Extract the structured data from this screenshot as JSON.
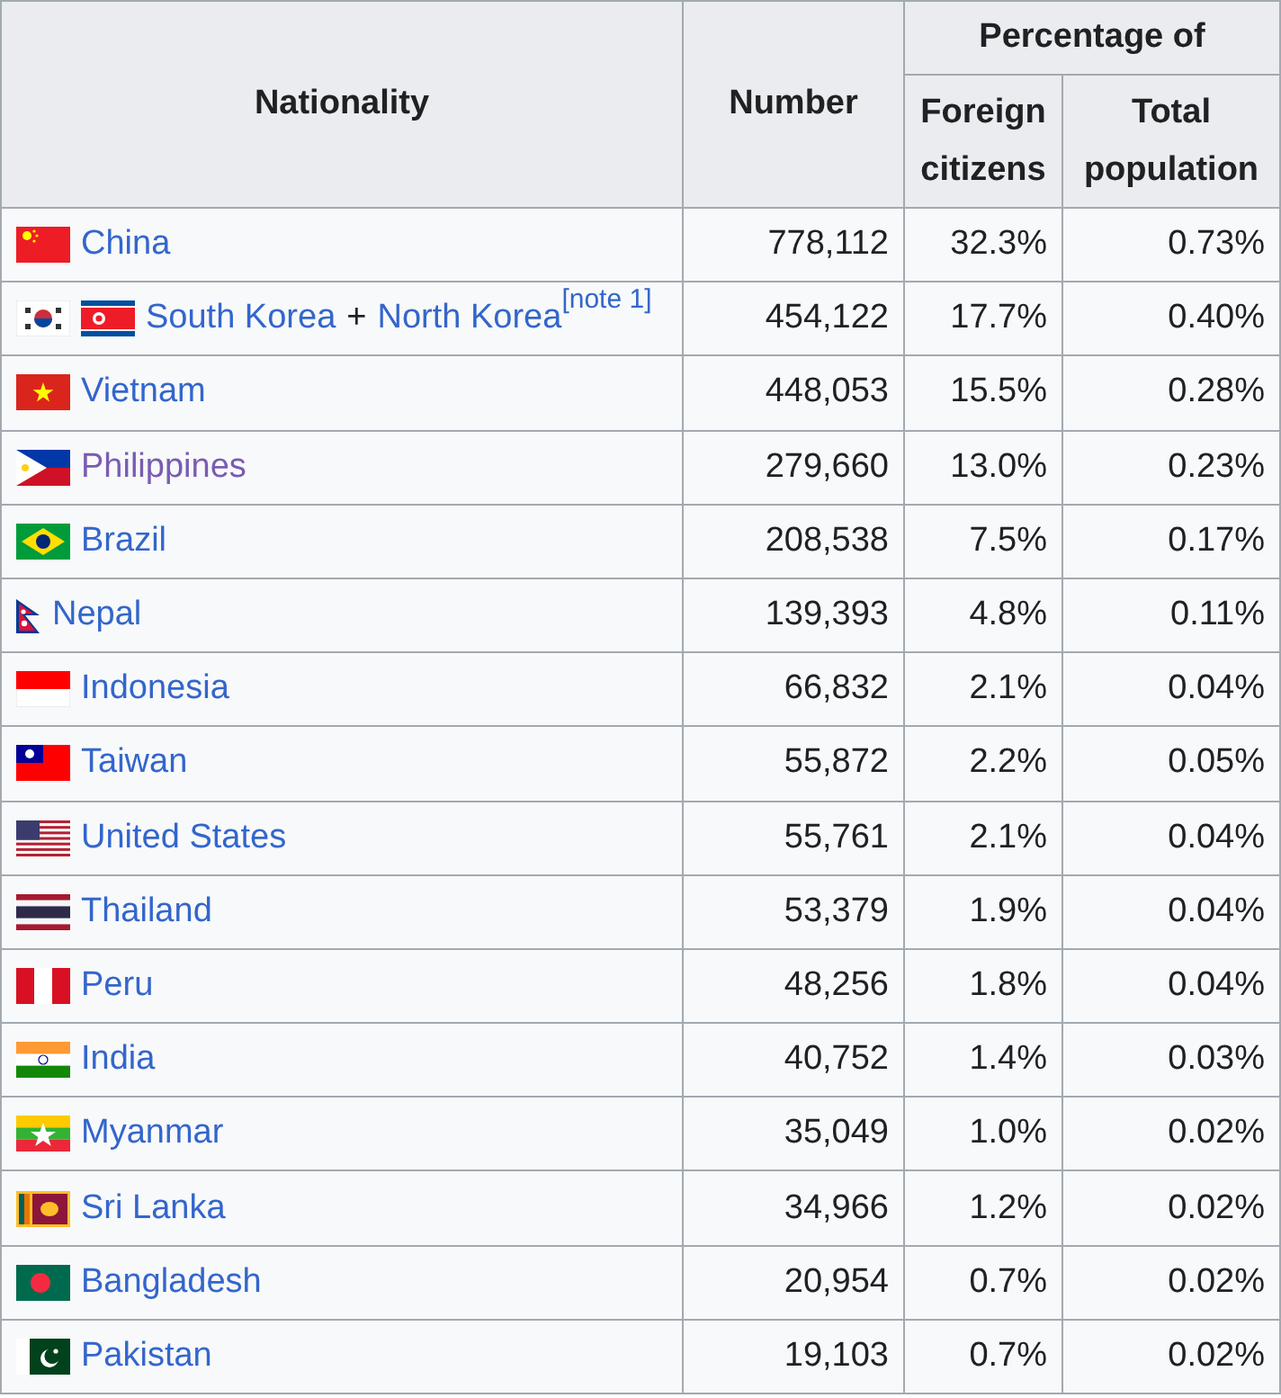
{
  "table": {
    "headers": {
      "nationality": "Nationality",
      "number": "Number",
      "percentage_of": "Percentage of",
      "foreign_citizens": "Foreign citizens",
      "total_population": "Total population"
    },
    "rows": [
      {
        "flags": [
          {
            "kind": "cn"
          }
        ],
        "name": [
          {
            "kind": "link",
            "text": "China",
            "visited": false
          }
        ],
        "number": "778,112",
        "foreign": "32.3%",
        "total": "0.73%"
      },
      {
        "flags": [
          {
            "kind": "kr"
          },
          {
            "kind": "kp"
          }
        ],
        "name": [
          {
            "kind": "link",
            "text": "South Korea",
            "visited": false
          },
          {
            "kind": "text",
            "text": "+"
          },
          {
            "kind": "link",
            "text": "North Korea",
            "visited": false
          },
          {
            "kind": "note",
            "text": "[note 1]"
          }
        ],
        "number": "454,122",
        "foreign": "17.7%",
        "total": "0.40%"
      },
      {
        "flags": [
          {
            "kind": "vn"
          }
        ],
        "name": [
          {
            "kind": "link",
            "text": "Vietnam",
            "visited": false
          }
        ],
        "number": "448,053",
        "foreign": "15.5%",
        "total": "0.28%"
      },
      {
        "flags": [
          {
            "kind": "ph"
          }
        ],
        "name": [
          {
            "kind": "link",
            "text": "Philippines",
            "visited": true
          }
        ],
        "number": "279,660",
        "foreign": "13.0%",
        "total": "0.23%"
      },
      {
        "flags": [
          {
            "kind": "br"
          }
        ],
        "name": [
          {
            "kind": "link",
            "text": "Brazil",
            "visited": false
          }
        ],
        "number": "208,538",
        "foreign": "7.5%",
        "total": "0.17%"
      },
      {
        "flags": [
          {
            "kind": "np"
          }
        ],
        "name": [
          {
            "kind": "link",
            "text": "Nepal",
            "visited": false
          }
        ],
        "number": "139,393",
        "foreign": "4.8%",
        "total": "0.11%"
      },
      {
        "flags": [
          {
            "kind": "id"
          }
        ],
        "name": [
          {
            "kind": "link",
            "text": "Indonesia",
            "visited": false
          }
        ],
        "number": "66,832",
        "foreign": "2.1%",
        "total": "0.04%"
      },
      {
        "flags": [
          {
            "kind": "tw"
          }
        ],
        "name": [
          {
            "kind": "link",
            "text": "Taiwan",
            "visited": false
          }
        ],
        "number": "55,872",
        "foreign": "2.2%",
        "total": "0.05%"
      },
      {
        "flags": [
          {
            "kind": "us"
          }
        ],
        "name": [
          {
            "kind": "link",
            "text": "United States",
            "visited": false
          }
        ],
        "number": "55,761",
        "foreign": "2.1%",
        "total": "0.04%"
      },
      {
        "flags": [
          {
            "kind": "th"
          }
        ],
        "name": [
          {
            "kind": "link",
            "text": "Thailand",
            "visited": false
          }
        ],
        "number": "53,379",
        "foreign": "1.9%",
        "total": "0.04%"
      },
      {
        "flags": [
          {
            "kind": "pe"
          }
        ],
        "name": [
          {
            "kind": "link",
            "text": "Peru",
            "visited": false
          }
        ],
        "number": "48,256",
        "foreign": "1.8%",
        "total": "0.04%"
      },
      {
        "flags": [
          {
            "kind": "in"
          }
        ],
        "name": [
          {
            "kind": "link",
            "text": "India",
            "visited": false
          }
        ],
        "number": "40,752",
        "foreign": "1.4%",
        "total": "0.03%"
      },
      {
        "flags": [
          {
            "kind": "mm"
          }
        ],
        "name": [
          {
            "kind": "link",
            "text": "Myanmar",
            "visited": false
          }
        ],
        "number": "35,049",
        "foreign": "1.0%",
        "total": "0.02%"
      },
      {
        "flags": [
          {
            "kind": "lk"
          }
        ],
        "name": [
          {
            "kind": "link",
            "text": "Sri Lanka",
            "visited": false
          }
        ],
        "number": "34,966",
        "foreign": "1.2%",
        "total": "0.02%"
      },
      {
        "flags": [
          {
            "kind": "bd"
          }
        ],
        "name": [
          {
            "kind": "link",
            "text": "Bangladesh",
            "visited": false
          }
        ],
        "number": "20,954",
        "foreign": "0.7%",
        "total": "0.02%"
      },
      {
        "flags": [
          {
            "kind": "pk"
          }
        ],
        "name": [
          {
            "kind": "link",
            "text": "Pakistan",
            "visited": false
          }
        ],
        "number": "19,103",
        "foreign": "0.7%",
        "total": "0.02%"
      }
    ]
  }
}
